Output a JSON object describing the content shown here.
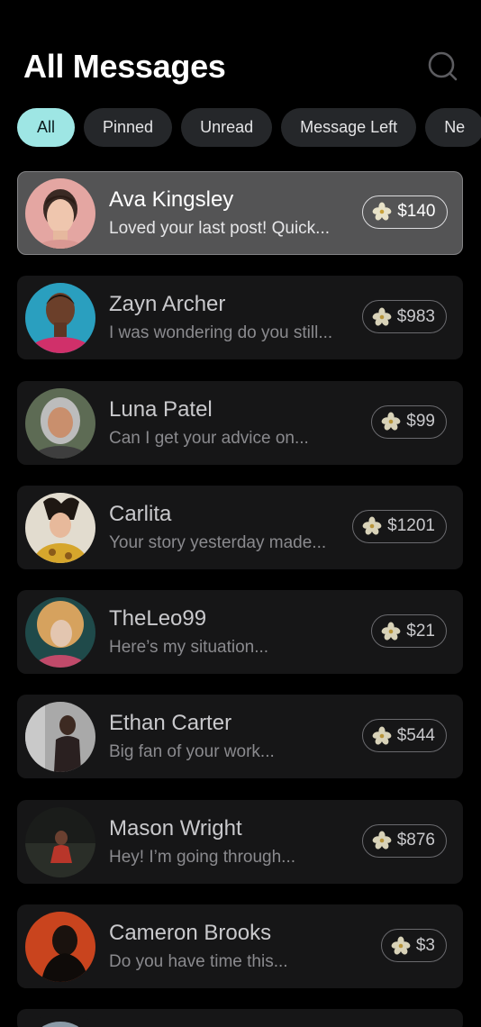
{
  "header": {
    "title": "All Messages"
  },
  "filters": [
    {
      "label": "All",
      "active": true
    },
    {
      "label": "Pinned",
      "active": false
    },
    {
      "label": "Unread",
      "active": false
    },
    {
      "label": "Message Left",
      "active": false
    },
    {
      "label": "Ne",
      "active": false
    }
  ],
  "conversations": [
    {
      "name": "Ava Kingsley",
      "preview": "Loved your last post! Quick...",
      "price": "$140",
      "selected": true
    },
    {
      "name": "Zayn Archer",
      "preview": "I was wondering do you still...",
      "price": "$983"
    },
    {
      "name": "Luna Patel",
      "preview": "Can I get your advice on...",
      "price": "$99"
    },
    {
      "name": "Carlita",
      "preview": "Your story yesterday made...",
      "price": "$1201"
    },
    {
      "name": "TheLeo99",
      "preview": "Here’s my situation...",
      "price": "$21"
    },
    {
      "name": "Ethan Carter",
      "preview": "Big fan of your work...",
      "price": "$544"
    },
    {
      "name": "Mason Wright",
      "preview": "Hey! I’m going through...",
      "price": "$876"
    },
    {
      "name": "Cameron Brooks",
      "preview": "Do you have time this...",
      "price": "$3"
    }
  ],
  "colors": {
    "background": "#000000",
    "card": "#161617",
    "card_selected": "#545455",
    "chip": "#25272a",
    "chip_active": "#9ee6e4"
  },
  "icons": {
    "search": "search-icon",
    "price_badge": "flower-icon"
  }
}
